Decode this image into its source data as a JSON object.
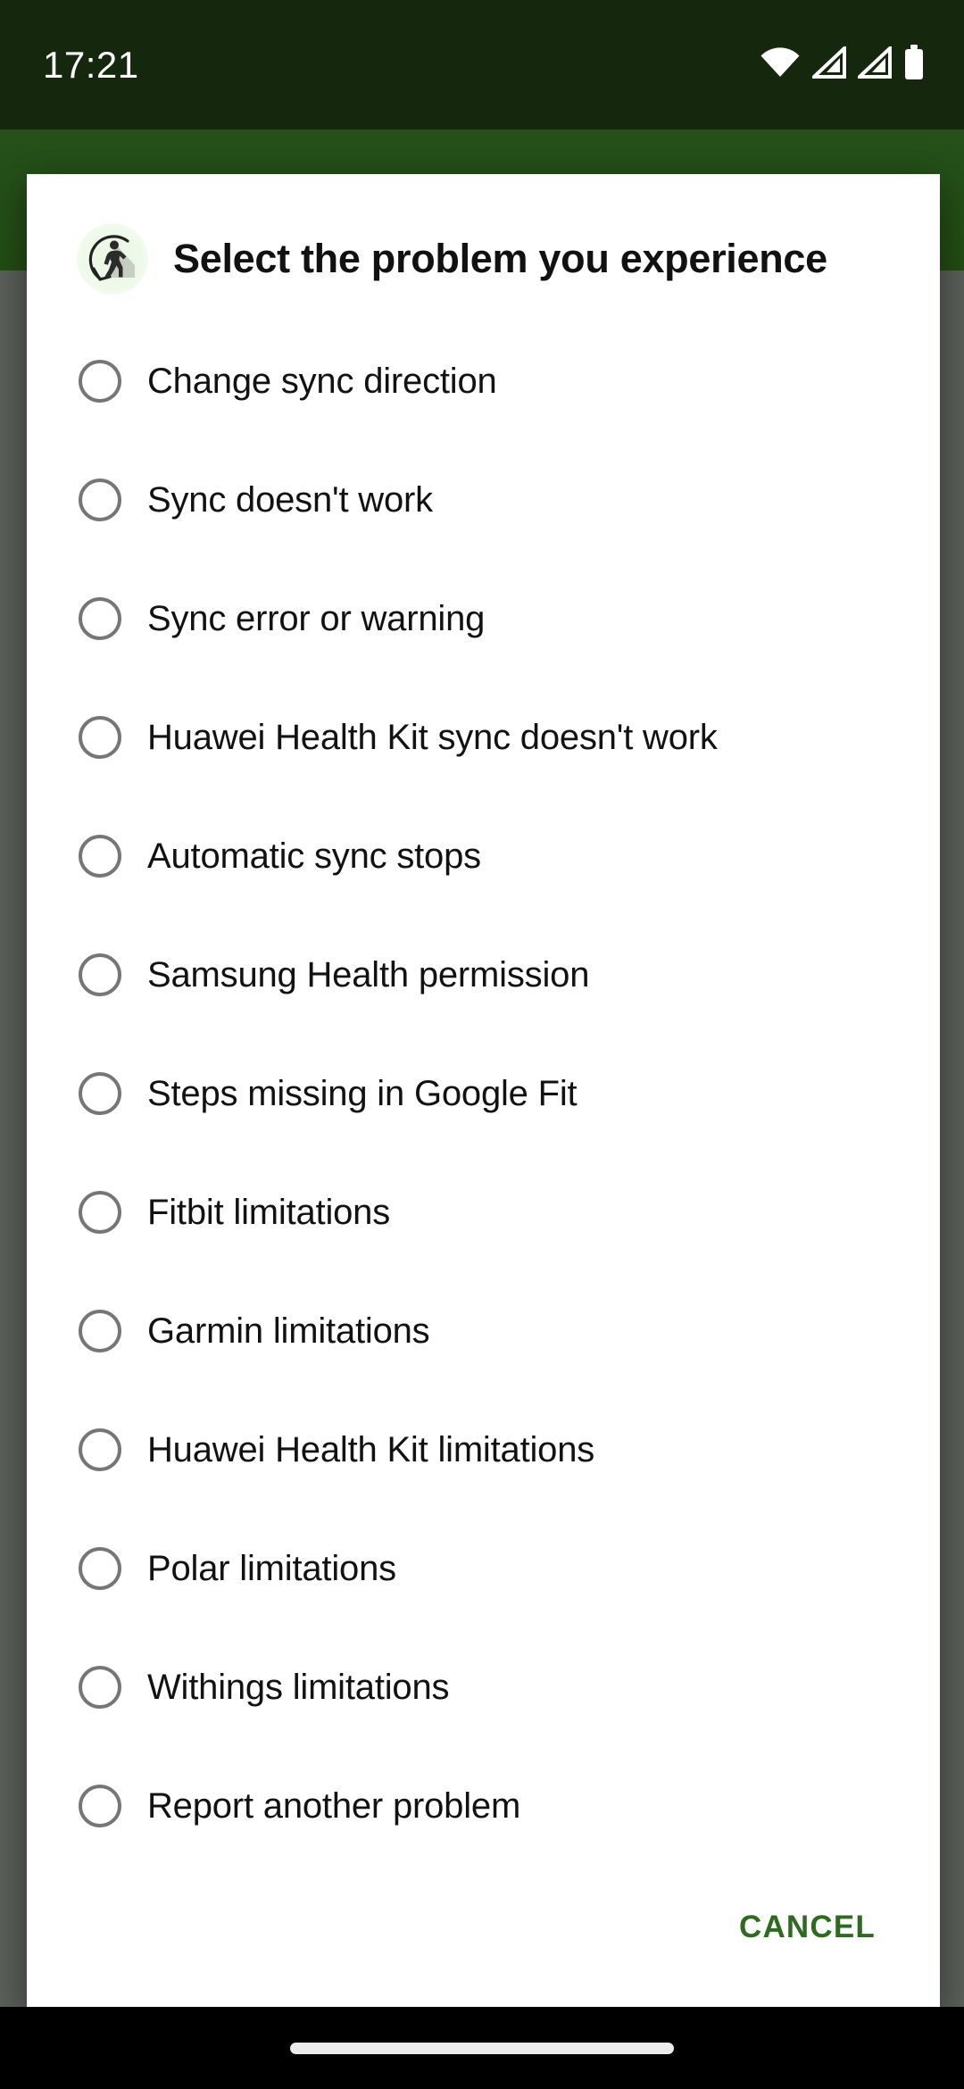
{
  "status_bar": {
    "time": "17:21",
    "icons": [
      {
        "name": "wifi-icon",
        "label": "Wi-Fi"
      },
      {
        "name": "cellular-signal-1-icon",
        "label": "Signal 1"
      },
      {
        "name": "cellular-signal-2-icon",
        "label": "Signal 2"
      },
      {
        "name": "battery-icon",
        "label": "Battery"
      }
    ],
    "background_color": "#15270c",
    "text_color": "#ffffff"
  },
  "app_bar": {
    "background_color": "#234d14"
  },
  "scrim": {
    "color": "#5b605a"
  },
  "dialog": {
    "icon_name": "walking-sync-icon",
    "title": "Select the problem you experience",
    "background_color": "#ffffff",
    "options": [
      {
        "label": "Change sync direction",
        "selected": false
      },
      {
        "label": "Sync doesn't work",
        "selected": false
      },
      {
        "label": "Sync error or warning",
        "selected": false
      },
      {
        "label": "Huawei Health Kit sync doesn't work",
        "selected": false
      },
      {
        "label": "Automatic sync stops",
        "selected": false
      },
      {
        "label": "Samsung Health permission",
        "selected": false
      },
      {
        "label": "Steps missing in Google Fit",
        "selected": false
      },
      {
        "label": "Fitbit limitations",
        "selected": false
      },
      {
        "label": "Garmin limitations",
        "selected": false
      },
      {
        "label": "Huawei Health Kit limitations",
        "selected": false
      },
      {
        "label": "Polar limitations",
        "selected": false
      },
      {
        "label": "Withings limitations",
        "selected": false
      },
      {
        "label": "Report another problem",
        "selected": false
      }
    ],
    "cancel_label": "CANCEL",
    "cancel_color": "#2d6b1e"
  },
  "nav_bar": {
    "background_color": "#000000",
    "gesture_pill_color": "#ececec"
  }
}
